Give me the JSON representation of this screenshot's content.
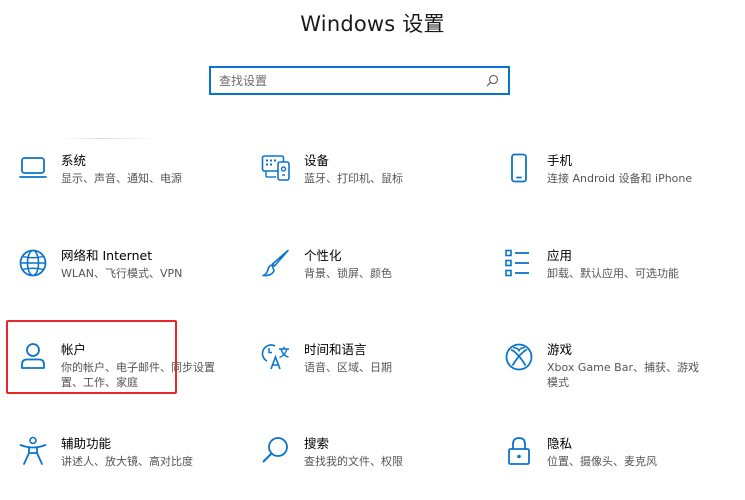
{
  "window": {
    "title": "Windows 设置"
  },
  "search": {
    "placeholder": "查找设置"
  },
  "tiles": [
    {
      "name": "系统",
      "desc": "显示、声音、通知、电源",
      "icon": "laptop-icon"
    },
    {
      "name": "设备",
      "desc": "蓝牙、打印机、鼠标",
      "icon": "keyboard-printer-icon"
    },
    {
      "name": "手机",
      "desc": "连接 Android 设备和 iPhone",
      "icon": "phone-icon"
    },
    {
      "name": "网络和 Internet",
      "desc": "WLAN、飞行模式、VPN",
      "icon": "globe-icon"
    },
    {
      "name": "个性化",
      "desc": "背景、锁屏、颜色",
      "icon": "brush-icon"
    },
    {
      "name": "应用",
      "desc": "卸载、默认应用、可选功能",
      "icon": "app-list-icon"
    },
    {
      "name": "帐户",
      "desc1": "你的帐户、电子邮件、同步设置",
      "desc2": "置、工作、家庭",
      "icon": "person-icon"
    },
    {
      "name": "时间和语言",
      "desc": "语音、区域、日期",
      "icon": "time-language-icon"
    },
    {
      "name": "游戏",
      "desc1": "Xbox Game Bar、捕获、游戏",
      "desc2": "模式",
      "icon": "xbox-icon"
    },
    {
      "name": "辅助功能",
      "desc": "讲述人、放大镜、高对比度",
      "icon": "accessibility-icon"
    },
    {
      "name": "搜索",
      "desc": "查找我的文件、权限",
      "icon": "search-icon"
    },
    {
      "name": "隐私",
      "desc": "位置、摄像头、麦克风",
      "icon": "lock-icon"
    }
  ],
  "colors": {
    "accent": "#0a74cc",
    "highlight": "#e8272b"
  }
}
